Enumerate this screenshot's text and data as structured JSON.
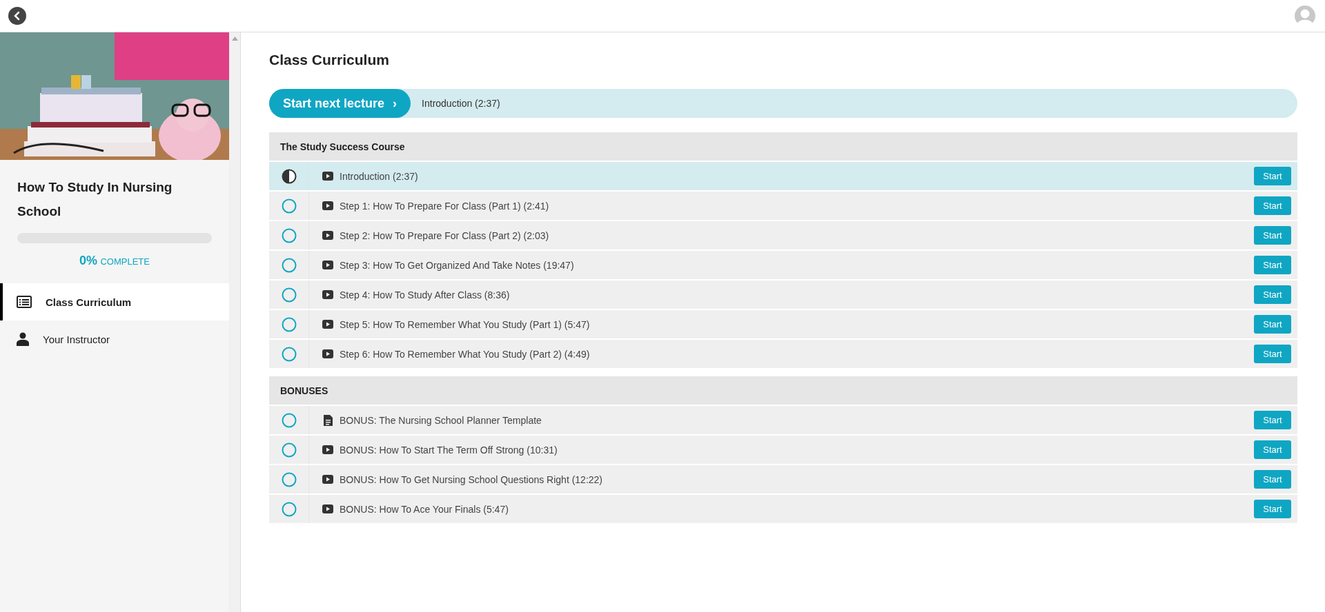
{
  "course": {
    "title": "How To Study In Nursing School",
    "progress": {
      "level": 0,
      "percent": "0%",
      "label": "COMPLETE"
    },
    "nav": [
      {
        "label": "Class Curriculum",
        "kind": "curriculum",
        "selected": true
      },
      {
        "label": "Your Instructor",
        "kind": "instructor",
        "selected": false
      }
    ]
  },
  "main": {
    "title": "Class Curriculum",
    "next_lecture": {
      "button": "Start next lecture",
      "arrow": "›",
      "lecture": "Introduction (2:37)"
    },
    "sections": [
      {
        "title": "The Study Success Course",
        "lectures": [
          {
            "title": "Introduction (2:37)",
            "kind": "video",
            "started": true,
            "selected": true,
            "button": "Start"
          },
          {
            "title": "Step 1: How To Prepare For Class (Part 1) (2:41)",
            "kind": "video",
            "started": false,
            "selected": false,
            "button": "Start"
          },
          {
            "title": "Step 2: How To Prepare For Class (Part 2) (2:03)",
            "kind": "video",
            "started": false,
            "selected": false,
            "button": "Start"
          },
          {
            "title": "Step 3: How To Get Organized And Take Notes (19:47)",
            "kind": "video",
            "started": false,
            "selected": false,
            "button": "Start"
          },
          {
            "title": "Step 4: How To Study After Class (8:36)",
            "kind": "video",
            "started": false,
            "selected": false,
            "button": "Start"
          },
          {
            "title": "Step 5: How To Remember What You Study (Part 1) (5:47)",
            "kind": "video",
            "started": false,
            "selected": false,
            "button": "Start"
          },
          {
            "title": "Step 6: How To Remember What You Study (Part 2) (4:49)",
            "kind": "video",
            "started": false,
            "selected": false,
            "button": "Start"
          }
        ]
      },
      {
        "title": "BONUSES",
        "lectures": [
          {
            "title": "BONUS: The Nursing School Planner Template",
            "kind": "document",
            "started": false,
            "selected": false,
            "button": "Start"
          },
          {
            "title": "BONUS: How To Start The Term Off Strong (10:31)",
            "kind": "video",
            "started": false,
            "selected": false,
            "button": "Start"
          },
          {
            "title": "BONUS: How To Get Nursing School Questions Right (12:22)",
            "kind": "video",
            "started": false,
            "selected": false,
            "button": "Start"
          },
          {
            "title": "BONUS: How To Ace Your Finals (5:47)",
            "kind": "video",
            "started": false,
            "selected": false,
            "button": "Start"
          }
        ]
      }
    ]
  }
}
